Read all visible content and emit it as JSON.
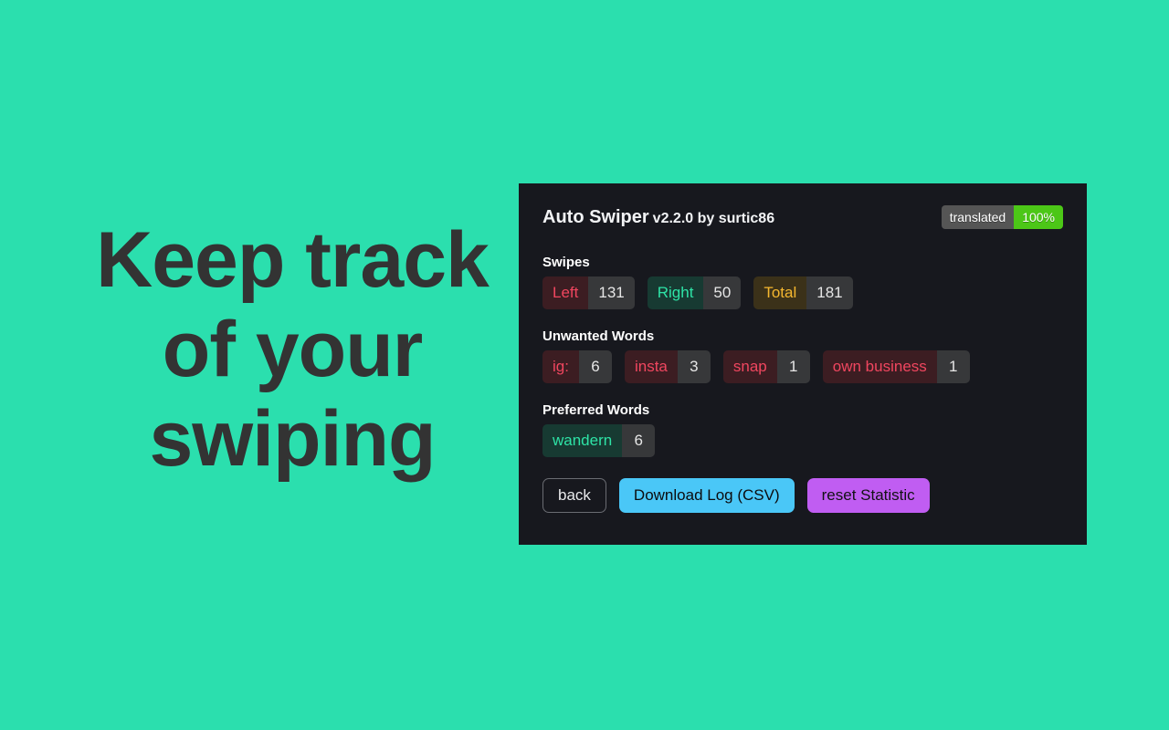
{
  "theme": {
    "page_background": "#2bdfae",
    "panel_background": "#17181e",
    "headline_color": "#333333",
    "accent_red": "#f0465f",
    "accent_green": "#2ee3a6",
    "accent_amber": "#f5b72f",
    "badge_gray": "#555555",
    "badge_green": "#4cc717",
    "button_primary": "#4ac7f7",
    "button_purple": "#c05df2"
  },
  "headline": {
    "lines": [
      "Keep track",
      "of your",
      "swiping"
    ]
  },
  "panel": {
    "header": {
      "app_name": "Auto Swiper",
      "version_by": "v2.2.0 by surtic86",
      "badge": {
        "label": "translated",
        "value": "100%"
      }
    },
    "sections": [
      {
        "label": "Swipes",
        "chips": [
          {
            "key": "Left",
            "value": "131",
            "tone": "red"
          },
          {
            "key": "Right",
            "value": "50",
            "tone": "green"
          },
          {
            "key": "Total",
            "value": "181",
            "tone": "amber"
          }
        ]
      },
      {
        "label": "Unwanted Words",
        "chips": [
          {
            "key": "ig:",
            "value": "6",
            "tone": "red"
          },
          {
            "key": "insta",
            "value": "3",
            "tone": "red"
          },
          {
            "key": "snap",
            "value": "1",
            "tone": "red"
          },
          {
            "key": "own business",
            "value": "1",
            "tone": "red"
          }
        ]
      },
      {
        "label": "Preferred Words",
        "chips": [
          {
            "key": "wandern",
            "value": "6",
            "tone": "green"
          }
        ]
      }
    ],
    "buttons": [
      {
        "label": "back",
        "style": "ghost"
      },
      {
        "label": "Download Log (CSV)",
        "style": "primary"
      },
      {
        "label": "reset Statistic",
        "style": "purple"
      }
    ]
  }
}
